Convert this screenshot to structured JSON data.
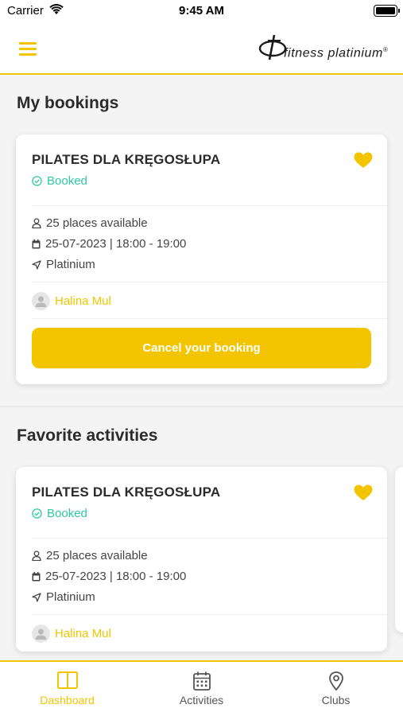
{
  "status_bar": {
    "carrier": "Carrier",
    "time": "9:45 AM"
  },
  "header": {
    "menu_icon": "hamburger-menu-icon",
    "logo_text": "fitness platinium",
    "logo_trademark": "®"
  },
  "sections": {
    "bookings": {
      "title": "My bookings",
      "card": {
        "name": "PILATES DLA KRĘGOSŁUPA",
        "status": "Booked",
        "places": "25 places available",
        "datetime": "25-07-2023 | 18:00 - 19:00",
        "location": "Platinium",
        "instructor": "Halina Mul",
        "action_label": "Cancel your booking"
      }
    },
    "favorites": {
      "title": "Favorite activities",
      "card": {
        "name": "PILATES DLA KRĘGOSŁUPA",
        "status": "Booked",
        "places": "25 places available",
        "datetime": "25-07-2023 | 18:00 - 19:00",
        "location": "Platinium",
        "instructor": "Halina Mul"
      }
    }
  },
  "tabs": [
    {
      "label": "Dashboard",
      "icon": "dashboard-icon",
      "active": true
    },
    {
      "label": "Activities",
      "icon": "calendar-icon",
      "active": false
    },
    {
      "label": "Clubs",
      "icon": "map-pin-icon",
      "active": false
    }
  ],
  "colors": {
    "accent": "#f2c500",
    "status_booked": "#2fc9a2",
    "text_dark": "#2b2b2b",
    "tab_inactive": "#555555",
    "background": "#f4f4f4"
  }
}
